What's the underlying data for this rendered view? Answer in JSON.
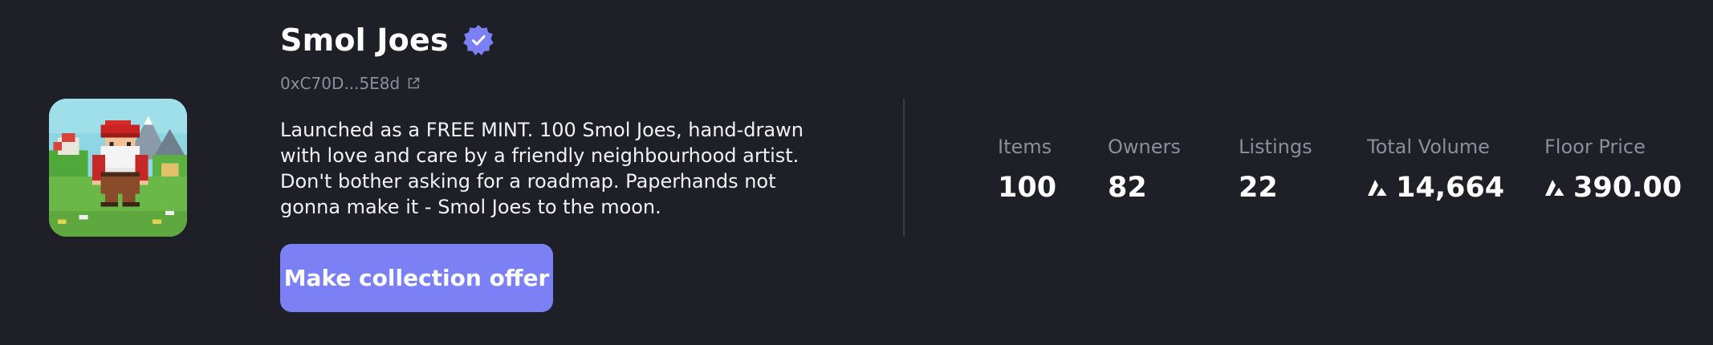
{
  "collection": {
    "title": "Smol Joes",
    "verified": true,
    "address": "0xC70D...5E8d",
    "description": "Launched as a FREE MINT. 100 Smol Joes, hand-drawn with love and care by a friendly neighbourhood artist. Don't bother asking for a roadmap. Paperhands not gonna make it - Smol Joes to the moon.",
    "offer_button_label": "Make collection offer",
    "icons": {
      "verified": "verified-badge-icon",
      "address_link": "external-link-icon",
      "currency": "avax-icon"
    },
    "colors": {
      "background": "#1f1f28",
      "accent": "#7b80f5",
      "muted_text": "#8e8e9b"
    }
  },
  "stats": {
    "items": {
      "label": "Items",
      "value": "100"
    },
    "owners": {
      "label": "Owners",
      "value": "82"
    },
    "listings": {
      "label": "Listings",
      "value": "22"
    },
    "total_volume": {
      "label": "Total Volume",
      "value": "14,664"
    },
    "floor_price": {
      "label": "Floor Price",
      "value": "390.00"
    }
  }
}
